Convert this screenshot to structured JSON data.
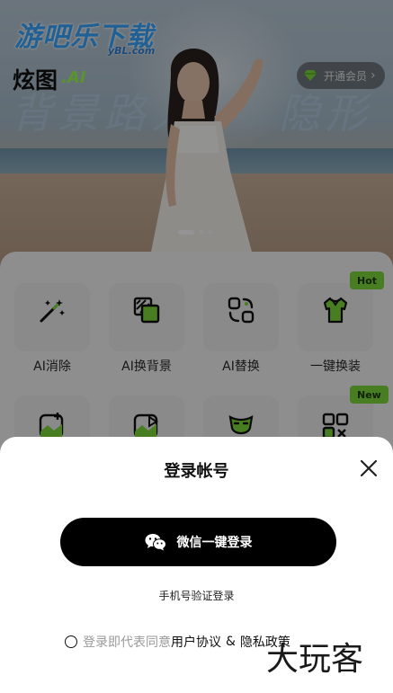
{
  "hero": {
    "site_logo_text": "游吧乐下载",
    "site_logo_sub": "yBL.com",
    "app_logo_text": "炫图",
    "app_logo_sub": ".AI",
    "banner_text_left": "背景路人",
    "banner_text_right": "隐形术",
    "vip_button_label": "开通会员",
    "slide_count": 3,
    "active_slide": 1
  },
  "tools": {
    "row1": [
      {
        "label": "AI消除",
        "icon": "magic-wand-icon"
      },
      {
        "label": "AI换背景",
        "icon": "layers-icon"
      },
      {
        "label": "AI替换",
        "icon": "swap-icon"
      },
      {
        "label": "一键换装",
        "icon": "shirt-icon",
        "badge": "Hot"
      }
    ],
    "row2": [
      {
        "label": "",
        "icon": "image-add-icon"
      },
      {
        "label": "",
        "icon": "image-video-icon"
      },
      {
        "label": "",
        "icon": "mask-icon"
      },
      {
        "label": "",
        "icon": "grid-check-icon",
        "badge": "New"
      }
    ]
  },
  "login": {
    "title": "登录帐号",
    "wechat_button_label": "微信一键登录",
    "phone_login_label": "手机号验证登录",
    "agree_prefix": "登录即代表同意",
    "user_agreement": "用户协议",
    "amp": "&",
    "privacy_policy": "隐私政策"
  },
  "watermark": "大玩客",
  "colors": {
    "accent_green": "#7ed83a",
    "button_black": "#000000",
    "site_logo_blue": "#3aa6ff"
  }
}
